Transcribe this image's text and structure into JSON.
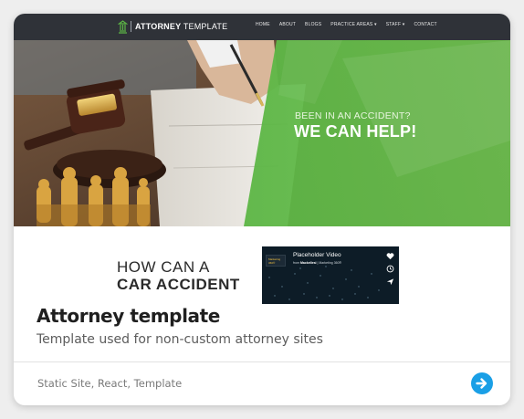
{
  "site_preview": {
    "logo": {
      "bold": "ATTORNEY",
      "light": "TEMPLATE"
    },
    "nav_items": [
      "HOME",
      "ABOUT",
      "BLOGS",
      "PRACTICE AREAS ▾",
      "STAFF ▾",
      "CONTACT"
    ],
    "hero": {
      "kicker": "BEEN IN AN ACCIDENT?",
      "headline": "WE CAN HELP!"
    },
    "section": {
      "heading_line1": "HOW CAN A",
      "heading_line2": "CAR ACCIDENT"
    },
    "video": {
      "title": "Placeholder Video",
      "sub_prefix": "from",
      "sub_author": "Mackellesi",
      "sub_rest": " | Marketing 360®",
      "thumb_text": "Marketing 360®"
    }
  },
  "card": {
    "title": "Attorney template",
    "description": "Template used for non-custom attorney sites",
    "tags": "Static Site, React, Template"
  },
  "colors": {
    "accent_blue": "#1a9fe6",
    "brand_green": "#5cb645",
    "nav_dark": "#2f3238"
  }
}
